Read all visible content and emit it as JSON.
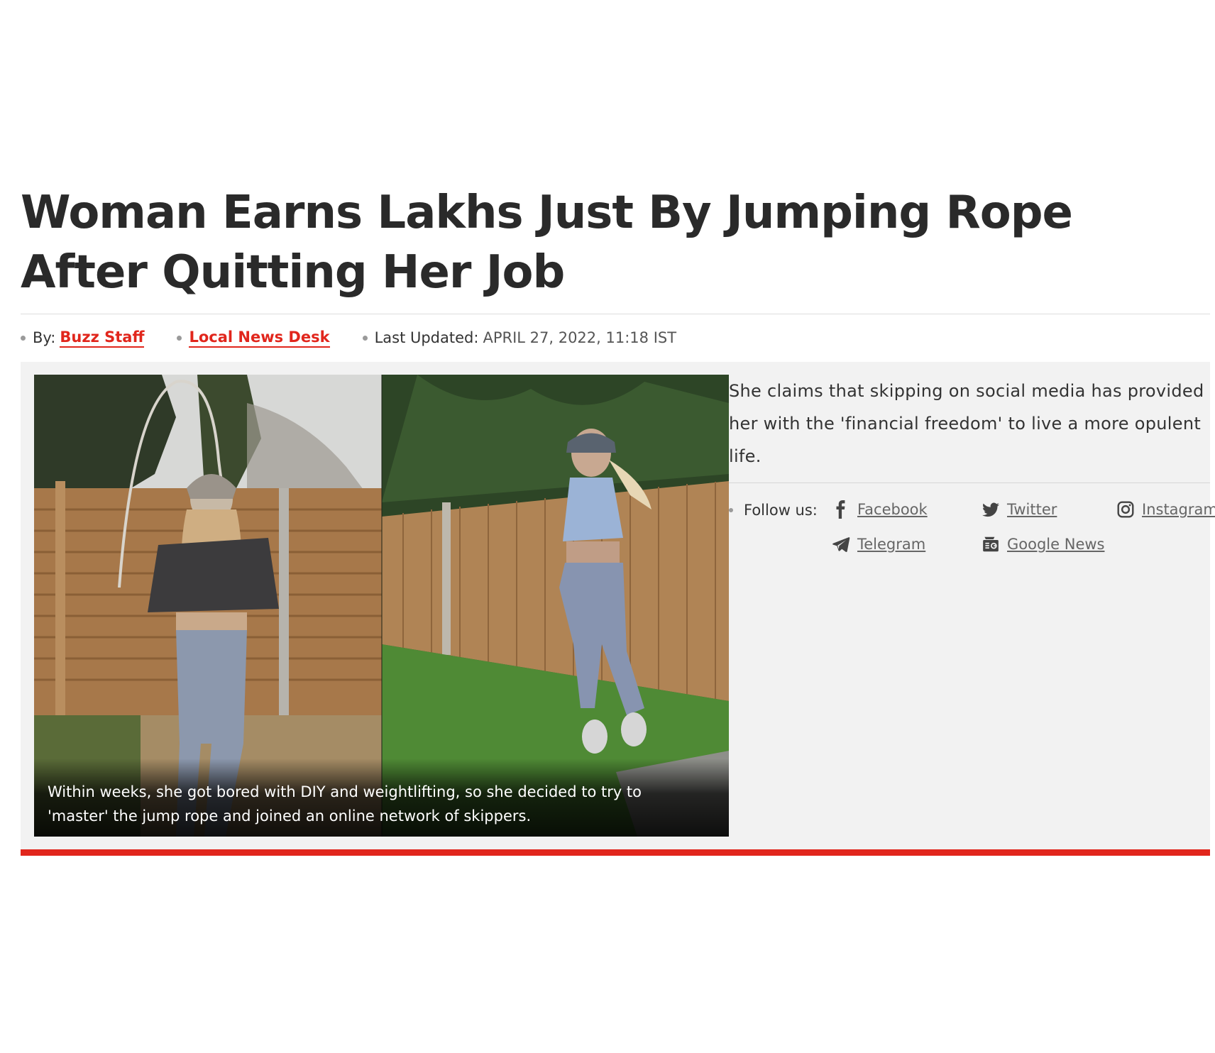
{
  "article": {
    "headline": "Woman Earns Lakhs Just By Jumping Rope After Quitting Her Job",
    "byline": {
      "by_label": "By:",
      "author": "Buzz Staff",
      "desk": "Local News Desk",
      "updated_label": "Last Updated:",
      "updated_value": "APRIL 27, 2022, 11:18 IST"
    },
    "image_caption": "Within weeks, she got bored with DIY and weightlifting, so she decided to try to 'master' the jump rope and joined an online network of skippers.",
    "summary": "She claims that skipping on social media has provided her with the 'financial freedom' to live a more opulent life."
  },
  "follow": {
    "label": "Follow us:",
    "links": [
      {
        "label": "Facebook",
        "icon": "facebook-icon"
      },
      {
        "label": "Twitter",
        "icon": "twitter-icon"
      },
      {
        "label": "Instagram",
        "icon": "instagram-icon"
      },
      {
        "label": "Telegram",
        "icon": "telegram-icon"
      },
      {
        "label": "Google News",
        "icon": "google-news-icon"
      }
    ]
  },
  "colors": {
    "accent_red": "#e1261c",
    "panel_bg": "#f2f2f2",
    "headline": "#2a2a2a"
  }
}
